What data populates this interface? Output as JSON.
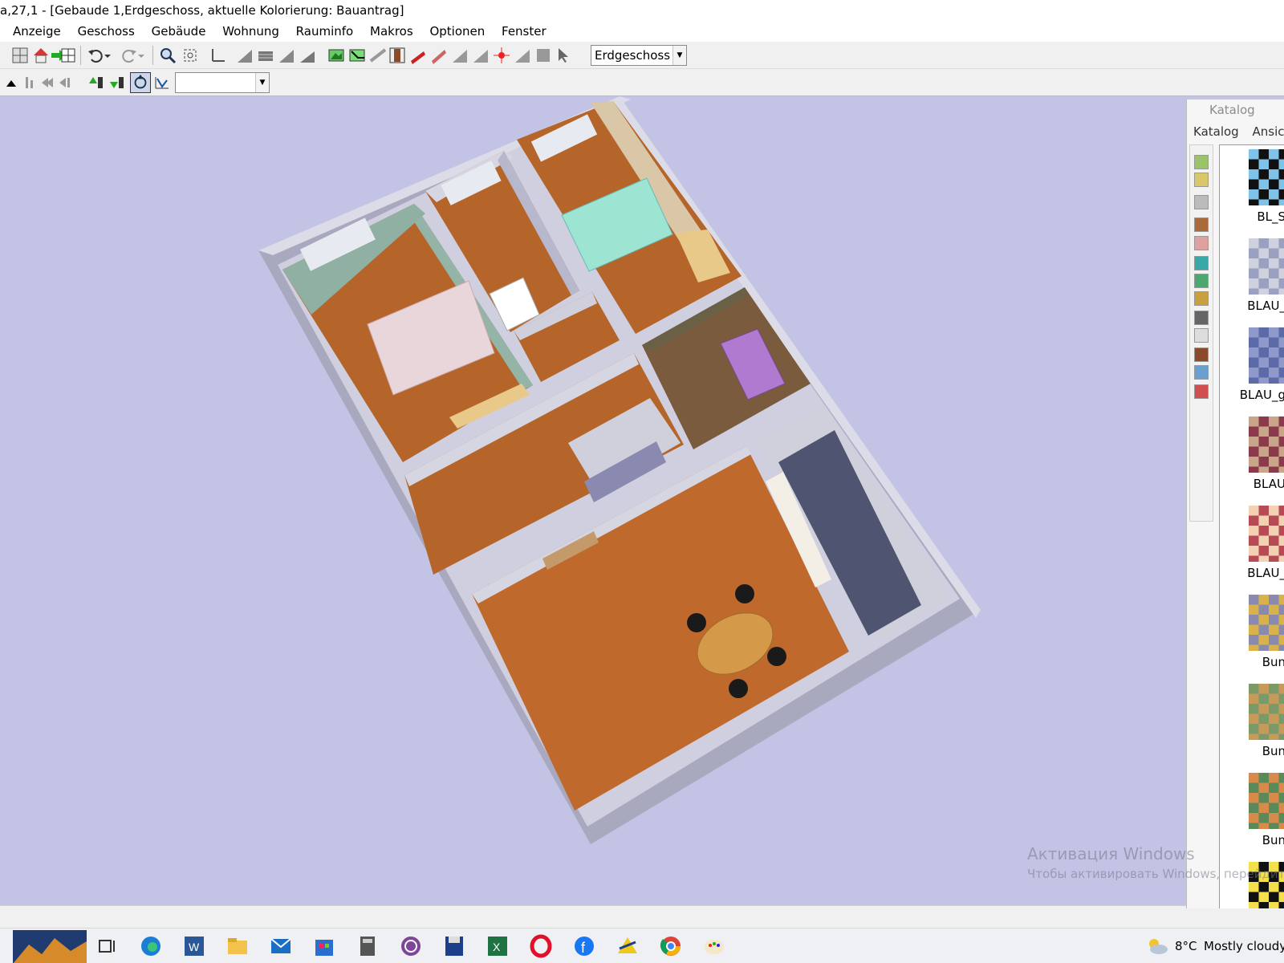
{
  "window": {
    "title": "a,27,1 - [Gebaude 1,Erdgeschoss, aktuelle Kolorierung: Bauantrag]"
  },
  "menu": {
    "items": [
      "Anzeige",
      "Geschoss",
      "Gebäude",
      "Wohnung",
      "Rauminfo",
      "Makros",
      "Optionen",
      "Fenster"
    ]
  },
  "toolbar": {
    "floor_select_value": "Erdgeschoss",
    "secondary_select_value": ""
  },
  "catalog": {
    "title": "Katalog",
    "menu": [
      "Katalog",
      "Ansicht"
    ],
    "items": [
      {
        "label": "BL_S"
      },
      {
        "label": "BLAU_"
      },
      {
        "label": "BLAU_g"
      },
      {
        "label": "BLAU"
      },
      {
        "label": "BLAU_"
      },
      {
        "label": "Bun"
      },
      {
        "label": "Bun"
      },
      {
        "label": "Bun"
      },
      {
        "label": ""
      }
    ]
  },
  "watermark": {
    "line1": "Активация Windows",
    "line2": "Чтобы активировать Windows, перейдите"
  },
  "taskbar": {
    "weather": {
      "temp": "8°C",
      "text": "Mostly cloudy"
    },
    "icons": [
      "task-view-icon",
      "edge-icon",
      "word-icon",
      "file-explorer-icon",
      "mail-icon",
      "store-icon",
      "calculator-icon",
      "tor-icon",
      "floppy-icon",
      "excel-icon",
      "opera-icon",
      "facebook-icon",
      "arcon-icon",
      "chrome-icon",
      "paint-icon"
    ]
  },
  "colors": {
    "background": "#c3c3e6",
    "floor_wood": "#b5652a",
    "wall_top": "#d8d9e6",
    "wall_side": "#a9a9bf"
  }
}
